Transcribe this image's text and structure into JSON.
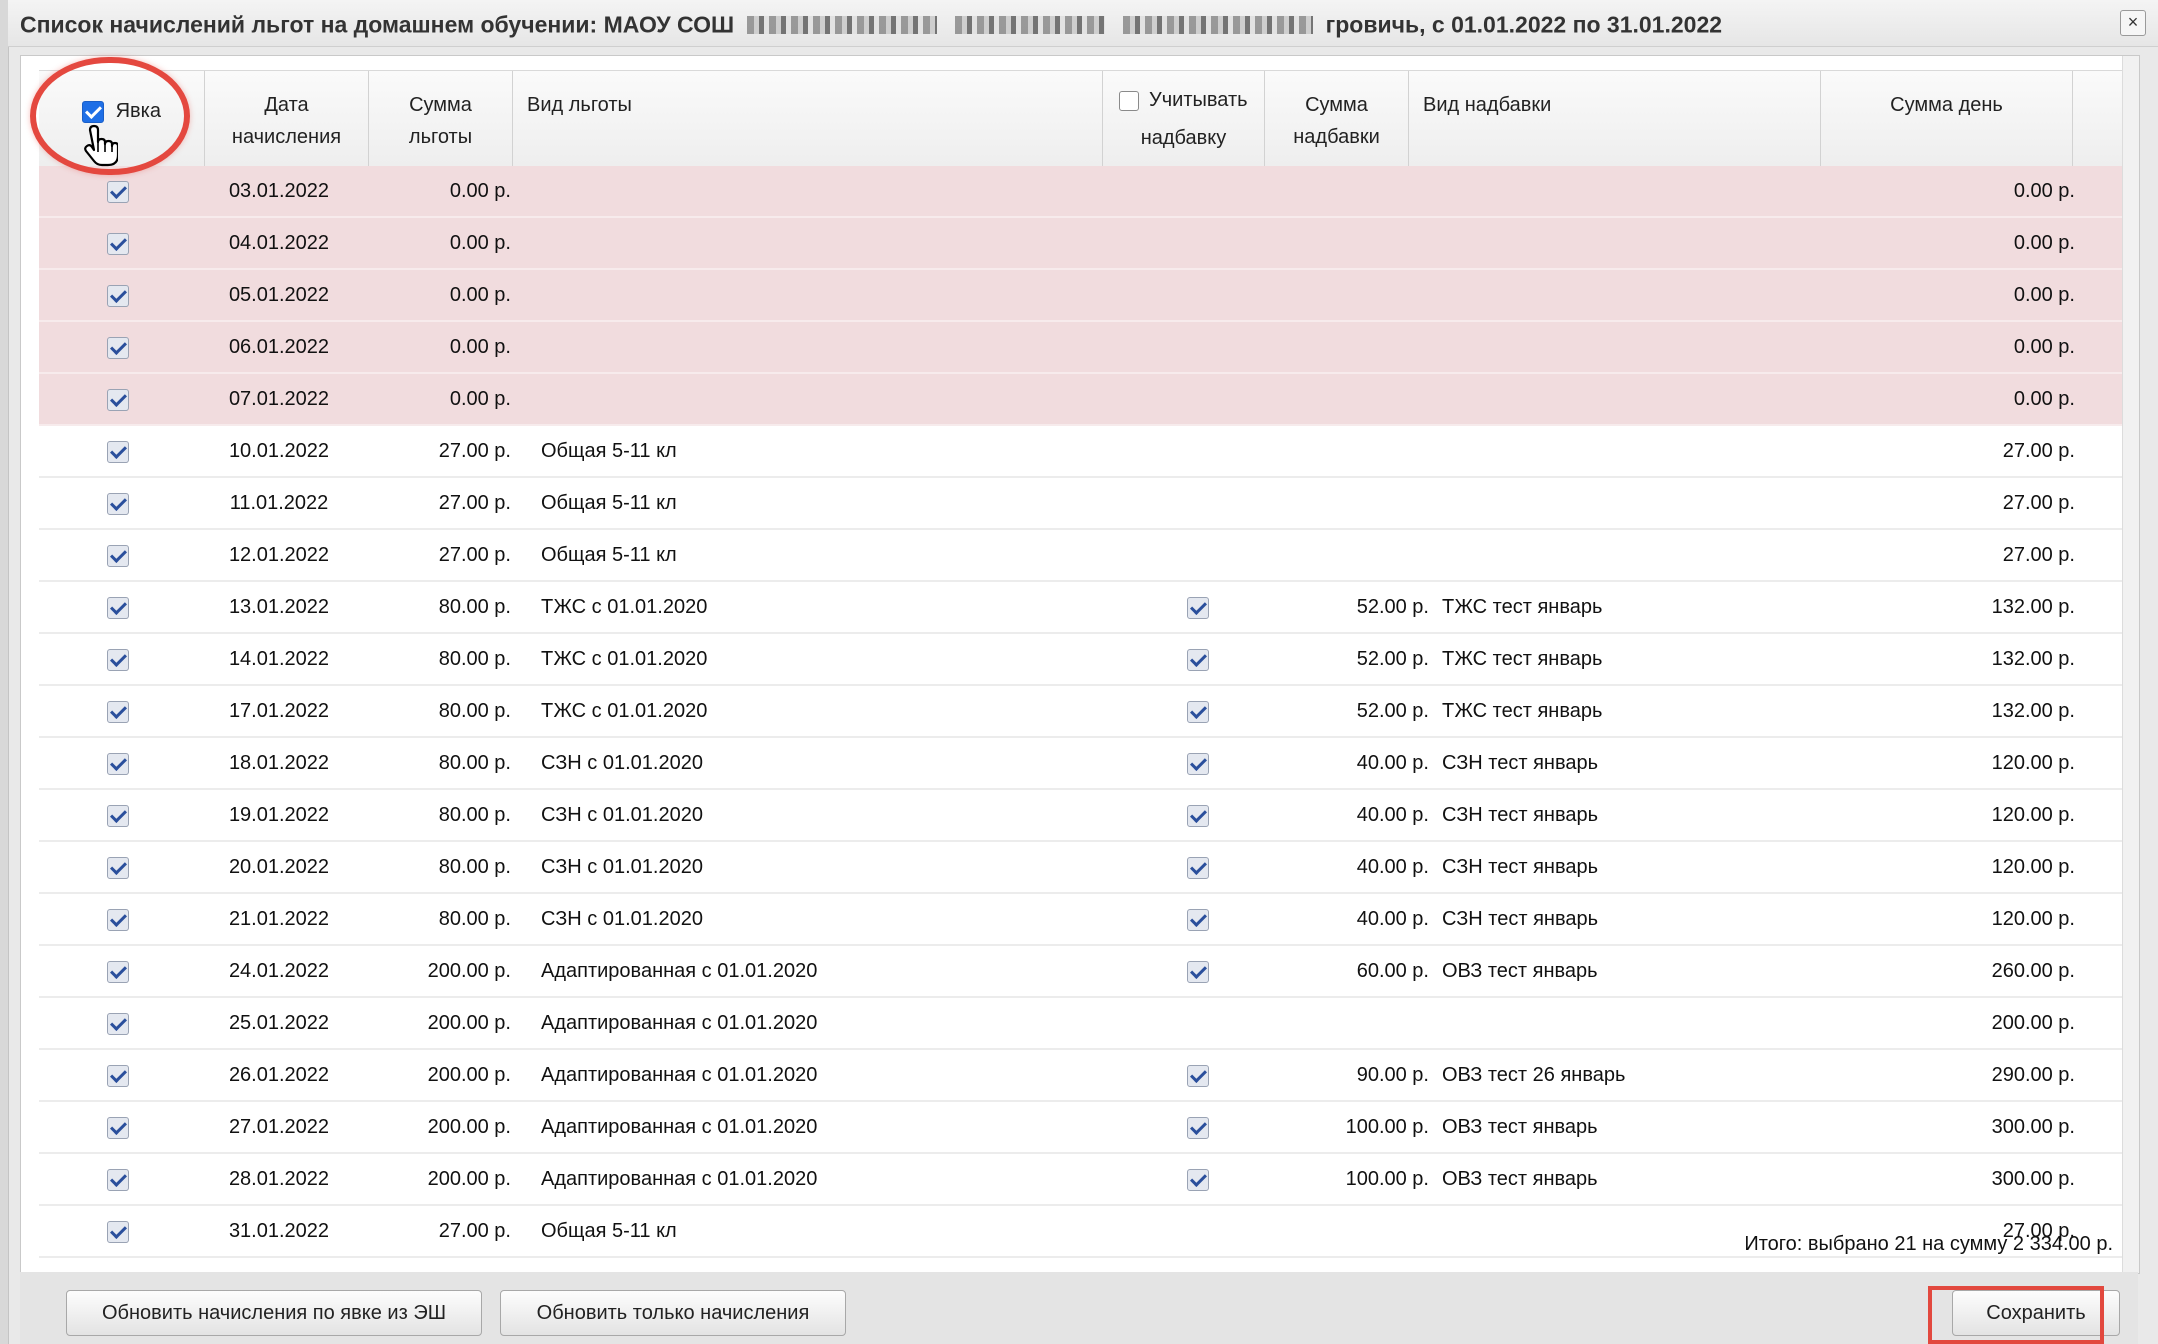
{
  "window": {
    "title_prefix": "Список начислений льгот на домашнем обучении: МАОУ СОШ",
    "title_suffix": "гровичь, с 01.01.2022 по 31.01.2022",
    "close_label": "×"
  },
  "header": {
    "attendance_label": "Явка",
    "date_label": "Дата начисления",
    "benefit_sum_label": "Сумма льготы",
    "benefit_type_label": "Вид льготы",
    "consider_bonus_label": "Учитывать надбавку",
    "bonus_sum_label": "Сумма надбавки",
    "bonus_type_label": "Вид надбавки",
    "day_sum_label": "Сумма день"
  },
  "rows": [
    {
      "date": "03.01.2022",
      "sum": "0.00 р.",
      "type": "",
      "bonus": false,
      "bonus_sum": "",
      "bonus_type": "",
      "day": "0.00 р.",
      "holiday": true
    },
    {
      "date": "04.01.2022",
      "sum": "0.00 р.",
      "type": "",
      "bonus": false,
      "bonus_sum": "",
      "bonus_type": "",
      "day": "0.00 р.",
      "holiday": true
    },
    {
      "date": "05.01.2022",
      "sum": "0.00 р.",
      "type": "",
      "bonus": false,
      "bonus_sum": "",
      "bonus_type": "",
      "day": "0.00 р.",
      "holiday": true
    },
    {
      "date": "06.01.2022",
      "sum": "0.00 р.",
      "type": "",
      "bonus": false,
      "bonus_sum": "",
      "bonus_type": "",
      "day": "0.00 р.",
      "holiday": true
    },
    {
      "date": "07.01.2022",
      "sum": "0.00 р.",
      "type": "",
      "bonus": false,
      "bonus_sum": "",
      "bonus_type": "",
      "day": "0.00 р.",
      "holiday": true
    },
    {
      "date": "10.01.2022",
      "sum": "27.00 р.",
      "type": "Общая 5-11 кл",
      "bonus": false,
      "bonus_sum": "",
      "bonus_type": "",
      "day": "27.00 р.",
      "holiday": false
    },
    {
      "date": "11.01.2022",
      "sum": "27.00 р.",
      "type": "Общая 5-11 кл",
      "bonus": false,
      "bonus_sum": "",
      "bonus_type": "",
      "day": "27.00 р.",
      "holiday": false
    },
    {
      "date": "12.01.2022",
      "sum": "27.00 р.",
      "type": "Общая 5-11 кл",
      "bonus": false,
      "bonus_sum": "",
      "bonus_type": "",
      "day": "27.00 р.",
      "holiday": false
    },
    {
      "date": "13.01.2022",
      "sum": "80.00 р.",
      "type": "ТЖС с 01.01.2020",
      "bonus": true,
      "bonus_sum": "52.00 р.",
      "bonus_type": "ТЖС тест январь",
      "day": "132.00 р.",
      "holiday": false
    },
    {
      "date": "14.01.2022",
      "sum": "80.00 р.",
      "type": "ТЖС с 01.01.2020",
      "bonus": true,
      "bonus_sum": "52.00 р.",
      "bonus_type": "ТЖС тест январь",
      "day": "132.00 р.",
      "holiday": false
    },
    {
      "date": "17.01.2022",
      "sum": "80.00 р.",
      "type": "ТЖС с 01.01.2020",
      "bonus": true,
      "bonus_sum": "52.00 р.",
      "bonus_type": "ТЖС тест январь",
      "day": "132.00 р.",
      "holiday": false
    },
    {
      "date": "18.01.2022",
      "sum": "80.00 р.",
      "type": "СЗН с 01.01.2020",
      "bonus": true,
      "bonus_sum": "40.00 р.",
      "bonus_type": "СЗН тест январь",
      "day": "120.00 р.",
      "holiday": false
    },
    {
      "date": "19.01.2022",
      "sum": "80.00 р.",
      "type": "СЗН с 01.01.2020",
      "bonus": true,
      "bonus_sum": "40.00 р.",
      "bonus_type": "СЗН тест январь",
      "day": "120.00 р.",
      "holiday": false
    },
    {
      "date": "20.01.2022",
      "sum": "80.00 р.",
      "type": "СЗН с 01.01.2020",
      "bonus": true,
      "bonus_sum": "40.00 р.",
      "bonus_type": "СЗН тест январь",
      "day": "120.00 р.",
      "holiday": false
    },
    {
      "date": "21.01.2022",
      "sum": "80.00 р.",
      "type": "СЗН с 01.01.2020",
      "bonus": true,
      "bonus_sum": "40.00 р.",
      "bonus_type": "СЗН тест январь",
      "day": "120.00 р.",
      "holiday": false
    },
    {
      "date": "24.01.2022",
      "sum": "200.00 р.",
      "type": "Адаптированная с 01.01.2020",
      "bonus": true,
      "bonus_sum": "60.00 р.",
      "bonus_type": "ОВЗ тест январь",
      "day": "260.00 р.",
      "holiday": false
    },
    {
      "date": "25.01.2022",
      "sum": "200.00 р.",
      "type": "Адаптированная с 01.01.2020",
      "bonus": false,
      "bonus_sum": "",
      "bonus_type": "",
      "day": "200.00 р.",
      "holiday": false
    },
    {
      "date": "26.01.2022",
      "sum": "200.00 р.",
      "type": "Адаптированная с 01.01.2020",
      "bonus": true,
      "bonus_sum": "90.00 р.",
      "bonus_type": "ОВЗ тест 26 январь",
      "day": "290.00 р.",
      "holiday": false
    },
    {
      "date": "27.01.2022",
      "sum": "200.00 р.",
      "type": "Адаптированная с 01.01.2020",
      "bonus": true,
      "bonus_sum": "100.00 р.",
      "bonus_type": "ОВЗ тест январь",
      "day": "300.00 р.",
      "holiday": false
    },
    {
      "date": "28.01.2022",
      "sum": "200.00 р.",
      "type": "Адаптированная с 01.01.2020",
      "bonus": true,
      "bonus_sum": "100.00 р.",
      "bonus_type": "ОВЗ тест январь",
      "day": "300.00 р.",
      "holiday": false
    },
    {
      "date": "31.01.2022",
      "sum": "27.00 р.",
      "type": "Общая 5-11 кл",
      "bonus": false,
      "bonus_sum": "",
      "bonus_type": "",
      "day": "27.00 р.",
      "holiday": false
    }
  ],
  "total_text": "Итого: выбрано 21 на сумму 2 334.00 р.",
  "buttons": {
    "refresh_by_attendance": "Обновить начисления по явке из ЭШ",
    "refresh_only": "Обновить только начисления",
    "save": "Сохранить"
  },
  "colors": {
    "holiday_row": "#f1dcde",
    "checkbox_accent": "#1f6fe6",
    "highlight_red": "#e4483f"
  }
}
